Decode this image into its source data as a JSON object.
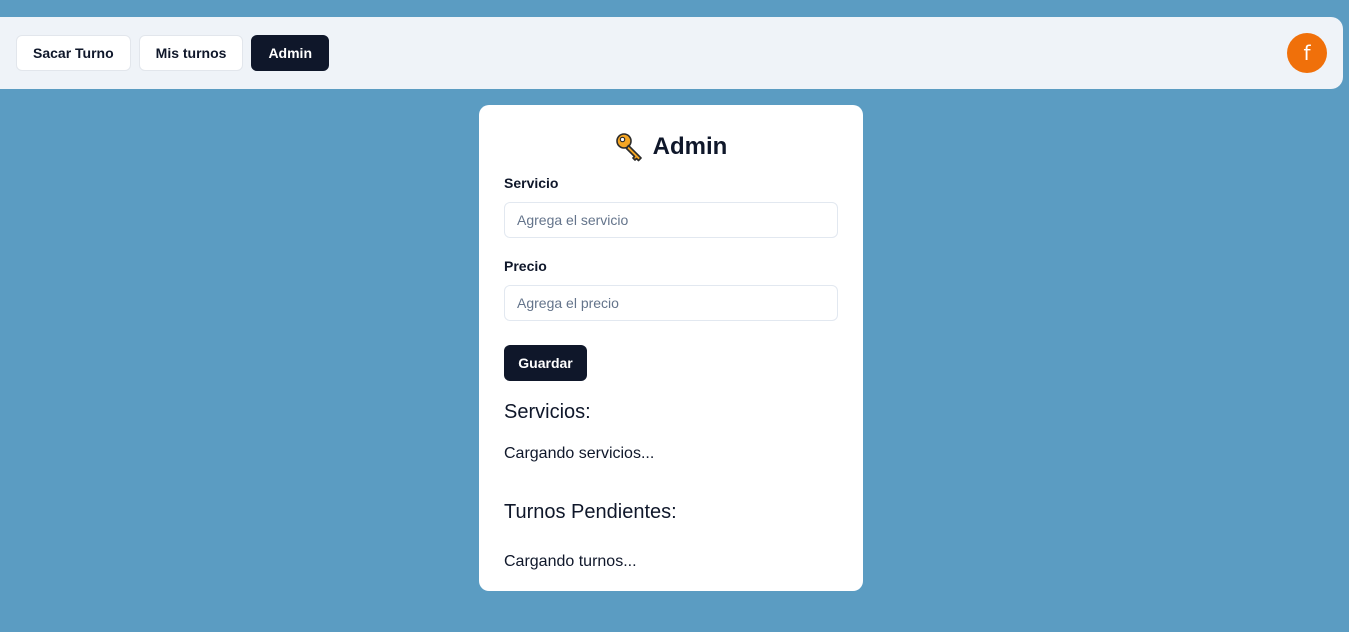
{
  "nav": {
    "items": [
      {
        "label": "Sacar Turno",
        "active": false
      },
      {
        "label": "Mis turnos",
        "active": false
      },
      {
        "label": "Admin",
        "active": true
      }
    ],
    "avatar_letter": "f",
    "avatar_color": "#f0700a"
  },
  "card": {
    "title": "Admin",
    "title_icon": "key-icon",
    "servicio": {
      "label": "Servicio",
      "placeholder": "Agrega el servicio",
      "value": ""
    },
    "precio": {
      "label": "Precio",
      "placeholder": "Agrega el precio",
      "value": ""
    },
    "save_label": "Guardar",
    "servicios_heading": "Servicios:",
    "servicios_loading": "Cargando servicios...",
    "turnos_heading": "Turnos Pendientes:",
    "turnos_loading": "Cargando turnos..."
  },
  "colors": {
    "background": "#5b9cc2",
    "primary_dark": "#0f172a",
    "avatar": "#f0700a"
  }
}
